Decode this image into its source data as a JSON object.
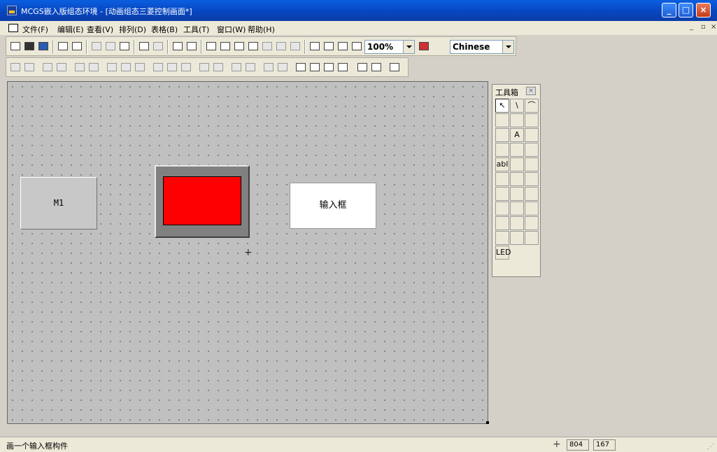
{
  "window": {
    "title": "MCGS嵌入版组态环境 - [动画组态三菱控制画面*]"
  },
  "menu": {
    "items": [
      "文件(F)",
      "编辑(E)",
      "查看(V)",
      "排列(D)",
      "表格(B)",
      "工具(T)",
      "窗口(W)",
      "帮助(H)"
    ]
  },
  "toolbar": {
    "zoom": "100%",
    "language": "Chinese"
  },
  "canvas": {
    "button_label": "M1",
    "lamp_color": "#ff0000",
    "input_label": "输入框"
  },
  "toolbox": {
    "title": "工具箱",
    "close": "×",
    "tools": [
      "pointer-icon",
      "line-icon",
      "arc-icon",
      "rect-icon",
      "rounded-rect-icon",
      "ellipse-icon",
      "polygon-icon",
      "text-icon",
      "bitmap-icon",
      "pipe-icon",
      "tank-icon",
      "symbol-lib-icon",
      "textbox-icon",
      "button-icon",
      "flow-icon",
      "valve-icon",
      "step-icon",
      "rotate-icon",
      "pump-icon",
      "gauge-icon",
      "led-dots-icon",
      "curve-icon",
      "history-curve-icon",
      "alarm-icon",
      "table-icon",
      "custom-table-icon",
      "storage-icon",
      "trend-icon",
      "report-icon",
      "pic-icon",
      "led-icon"
    ],
    "labels": {
      "arrow": "↖",
      "line": "\\",
      "arc": "⌒",
      "text": "A",
      "textbox": "abl",
      "led": "LED"
    }
  },
  "status": {
    "message": "画一个输入框构件",
    "x": "804",
    "y": "167"
  }
}
